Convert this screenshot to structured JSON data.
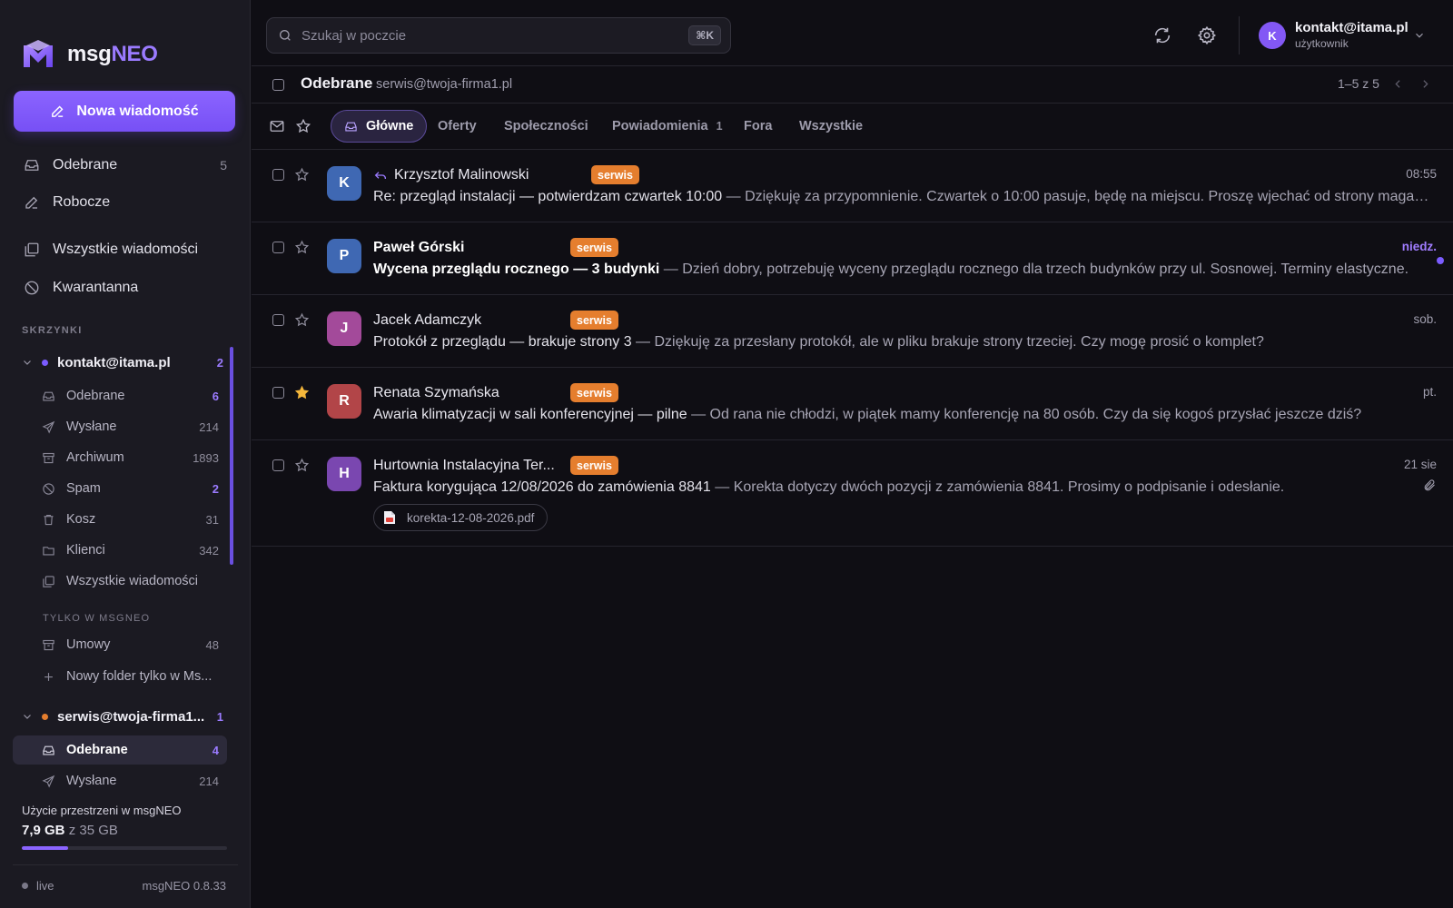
{
  "brand": {
    "name_a": "msg",
    "name_b": "NEO"
  },
  "compose_label": "Nowa wiadomość",
  "nav": {
    "inbox": {
      "label": "Odebrane",
      "count": "5"
    },
    "drafts": {
      "label": "Robocze"
    },
    "all": {
      "label": "Wszystkie wiadomości"
    },
    "quarantine": {
      "label": "Kwarantanna"
    }
  },
  "sections": {
    "mailboxes": "SKRZYNKI",
    "only_msgneo": "TYLKO W MSGNEO"
  },
  "accounts": [
    {
      "email": "kontakt@itama.pl",
      "count": "2",
      "dot_color": "#7b5cff",
      "folders": [
        {
          "label": "Odebrane",
          "count": "6",
          "icon": "inbox-icon"
        },
        {
          "label": "Wysłane",
          "count": "214",
          "icon": "send-icon"
        },
        {
          "label": "Archiwum",
          "count": "1893",
          "icon": "archive-icon"
        },
        {
          "label": "Spam",
          "count": "2",
          "icon": "spam-icon"
        },
        {
          "label": "Kosz",
          "count": "31",
          "icon": "trash-icon"
        },
        {
          "label": "Klienci",
          "count": "342",
          "icon": "folder-icon"
        },
        {
          "label": "Wszystkie wiadomości",
          "count": "",
          "icon": "all-mail-icon"
        }
      ],
      "local_folders": [
        {
          "label": "Umowy",
          "count": "48",
          "icon": "archive-icon"
        },
        {
          "label": "Nowy folder tylko w Ms...",
          "count": "",
          "icon": "plus-icon"
        }
      ]
    },
    {
      "email": "serwis@twoja-firma1...",
      "count": "1",
      "dot_color": "#e57e2e",
      "folders": [
        {
          "label": "Odebrane",
          "count": "4",
          "icon": "inbox-icon",
          "active": true
        },
        {
          "label": "Wysłane",
          "count": "214",
          "icon": "send-icon"
        }
      ]
    }
  ],
  "storage": {
    "label": "Użycie przestrzeni w msgNEO",
    "used": "7,9 GB",
    "total": "z 35 GB",
    "fraction": 0.226
  },
  "footer": {
    "status": "live",
    "version": "msgNEO 0.8.33"
  },
  "search": {
    "placeholder": "Szukaj w poczcie",
    "shortcut": "⌘K"
  },
  "user": {
    "initial": "K",
    "email": "kontakt@itama.pl",
    "role": "użytkownik"
  },
  "folder_header": {
    "title": "Odebrane",
    "account": "serwis@twoja-firma1.pl",
    "pager": "1–5 z 5"
  },
  "tabs": [
    {
      "label": "Główne",
      "active": true,
      "badge": ""
    },
    {
      "label": "Oferty",
      "badge": ""
    },
    {
      "label": "Społeczności",
      "badge": ""
    },
    {
      "label": "Powiadomienia",
      "badge": "1"
    },
    {
      "label": "Fora",
      "badge": ""
    },
    {
      "label": "Wszystkie",
      "badge": ""
    }
  ],
  "messages": [
    {
      "initial": "K",
      "avatar_color": "#3f68b3",
      "sender": "Krzysztof Malinowski",
      "replied": true,
      "unread": false,
      "starred": false,
      "tag": "serwis",
      "time": "08:55",
      "subject": "Re: przegląd instalacji — potwierdzam czwartek 10:00",
      "preview": " — Dziękuję za przypomnienie. Czwartek o 10:00 pasuje, będę na miejscu. Proszę wjechać od strony magazynu."
    },
    {
      "initial": "P",
      "avatar_color": "#3f68b3",
      "sender": "Paweł Górski",
      "replied": false,
      "unread": true,
      "starred": false,
      "tag": "serwis",
      "time": "niedz.",
      "subject": "Wycena przeglądu rocznego — 3 budynki",
      "preview": " — Dzień dobry, potrzebuję wyceny przeglądu rocznego dla trzech budynków przy ul. Sosnowej. Terminy elastyczne."
    },
    {
      "initial": "J",
      "avatar_color": "#a34a9a",
      "sender": "Jacek Adamczyk",
      "replied": false,
      "unread": false,
      "starred": false,
      "tag": "serwis",
      "time": "sob.",
      "subject": "Protokół z przeglądu — brakuje strony 3",
      "preview": " — Dziękuję za przesłany protokół, ale w pliku brakuje strony trzeciej. Czy mogę prosić o komplet?"
    },
    {
      "initial": "R",
      "avatar_color": "#b24548",
      "sender": "Renata Szymańska",
      "replied": false,
      "unread": false,
      "starred": true,
      "tag": "serwis",
      "time": "pt.",
      "subject": "Awaria klimatyzacji w sali konferencyjnej — pilne",
      "preview": " — Od rana nie chłodzi, w piątek mamy konferencję na 80 osób. Czy da się kogoś przysłać jeszcze dziś?"
    },
    {
      "initial": "H",
      "avatar_color": "#7a47b0",
      "sender": "Hurtownia Instalacyjna Ter...",
      "replied": false,
      "unread": false,
      "starred": false,
      "tag": "serwis",
      "time": "21 sie",
      "subject": "Faktura korygująca 12/08/2026 do zamówienia 8841",
      "preview": " — Korekta dotyczy dwóch pozycji z zamówienia 8841. Prosimy o podpisanie i odesłanie.",
      "attachment": "korekta-12-08-2026.pdf"
    }
  ]
}
